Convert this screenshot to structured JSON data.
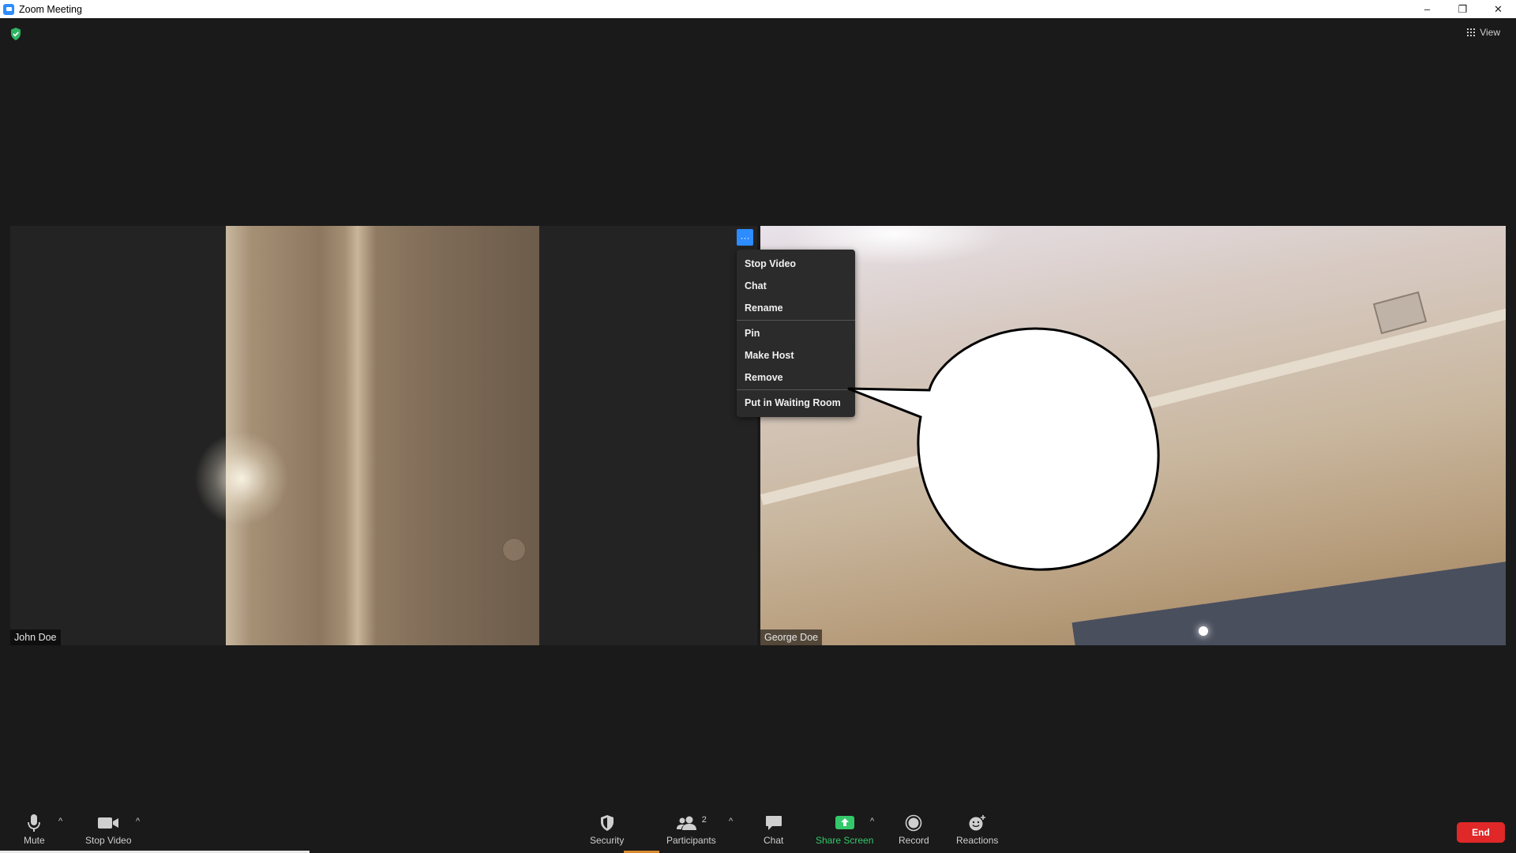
{
  "window": {
    "title": "Zoom Meeting",
    "controls": {
      "minimize": "–",
      "restore": "❐",
      "close": "✕"
    }
  },
  "header": {
    "shield_icon": "shield-check-icon",
    "view_label": "View"
  },
  "participants": [
    {
      "name": "John Doe"
    },
    {
      "name": "George Doe"
    }
  ],
  "more_button": {
    "label": "···"
  },
  "context_menu": {
    "items": [
      "Stop Video",
      "Chat",
      "Rename",
      "Pin",
      "Make Host",
      "Remove",
      "Put in Waiting Room"
    ]
  },
  "toolbar": {
    "mute": "Mute",
    "stop_video": "Stop Video",
    "security": "Security",
    "participants": "Participants",
    "participants_count": "2",
    "chat": "Chat",
    "share_screen": "Share Screen",
    "record": "Record",
    "reactions": "Reactions",
    "end": "End",
    "caret": "^"
  },
  "colors": {
    "accent": "#2d8cff",
    "share_green": "#33c86a",
    "end_red": "#e02828",
    "background": "#1a1a1a"
  }
}
